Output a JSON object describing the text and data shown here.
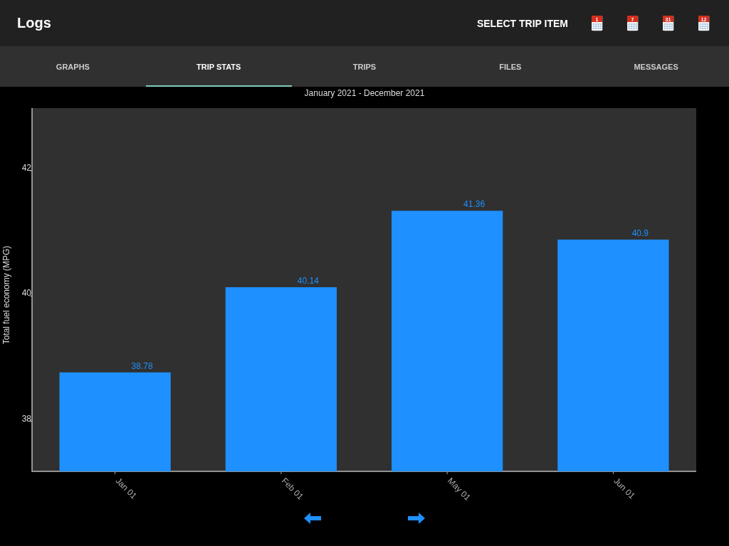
{
  "app_bar": {
    "title": "Logs",
    "action": "SELECT TRIP ITEM",
    "calendar_buttons": [
      {
        "day": "1"
      },
      {
        "day": "7"
      },
      {
        "day": "31"
      },
      {
        "day": "12"
      }
    ]
  },
  "tabs": [
    {
      "label": "GRAPHS",
      "selected": false
    },
    {
      "label": "TRIP STATS",
      "selected": true
    },
    {
      "label": "TRIPS",
      "selected": false
    },
    {
      "label": "FILES",
      "selected": false
    },
    {
      "label": "MESSAGES",
      "selected": false
    }
  ],
  "period": "January 2021 - December 2021",
  "chart": {
    "chart_data": {
      "type": "bar",
      "ylabel": "Total fuel economy (MPG)",
      "categories": [
        "Jan 01",
        "Feb 01",
        "May 01",
        "Jun 01"
      ],
      "series": [
        {
          "color": "#1e90ff",
          "values": [
            38.78,
            40.14,
            41.36,
            40.9
          ]
        }
      ],
      "ylim": [
        37.2,
        43.0
      ],
      "yticks": [
        38,
        40,
        42
      ],
      "data_labels": true,
      "value_labels": [
        "38.78",
        "40.14",
        "41.36",
        "40.9"
      ]
    }
  },
  "navigation": [
    {
      "kind": "previous"
    },
    {
      "kind": "next"
    }
  ]
}
